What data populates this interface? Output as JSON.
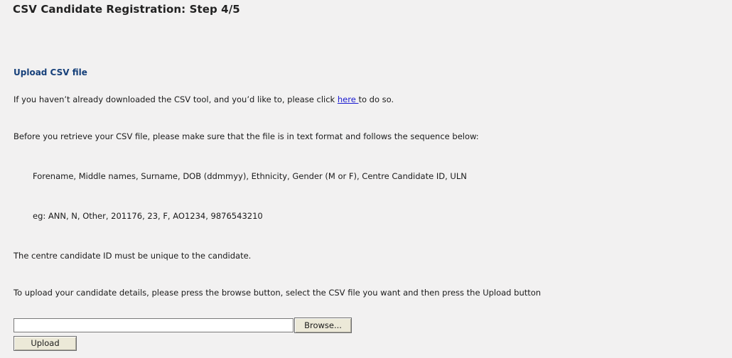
{
  "page": {
    "title": "CSV Candidate Registration: Step 4/5"
  },
  "section": {
    "heading": "Upload CSV file",
    "download_text_before": "If you haven’t already downloaded the CSV tool, and you’d like to, please click ",
    "download_link": "here ",
    "download_text_after": "to do so.",
    "sequence_intro": "Before you retrieve your CSV file, please make sure that the file is in text format and follows the sequence below:",
    "sequence": "Forename, Middle names, Surname, DOB (ddmmyy), Ethnicity, Gender (M or F), Centre Candidate ID, ULN",
    "example": "eg: ANN, N, Other, 201176, 23, F, AO1234, 9876543210",
    "unique_note": "The centre candidate ID must be unique to the candidate.",
    "upload_instructions": "To upload your candidate details, please press the browse button, select the CSV file you want and then press the Upload button"
  },
  "form": {
    "file_value": "",
    "browse_label": "Browse...",
    "upload_label": "Upload"
  }
}
